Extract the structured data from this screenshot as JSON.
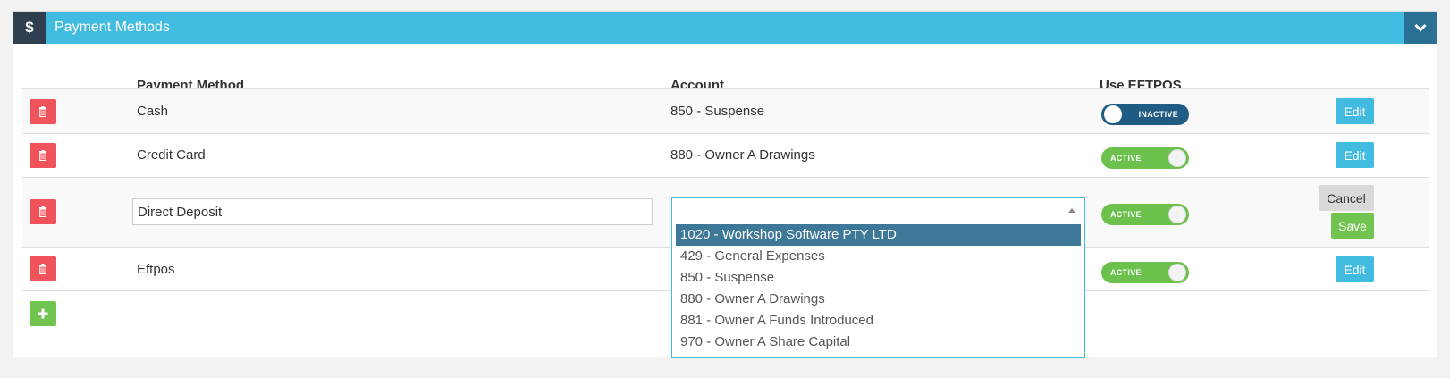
{
  "header": {
    "title": "Payment Methods",
    "icon": "$"
  },
  "columns": {
    "method": "Payment Method",
    "account": "Account",
    "eftpos": "Use EFTPOS"
  },
  "rows": [
    {
      "method": "Cash",
      "account": "850 - Suspense",
      "eftpos": "INACTIVE",
      "action": "Edit"
    },
    {
      "method": "Credit Card",
      "account": "880 - Owner A Drawings",
      "eftpos": "ACTIVE",
      "action": "Edit"
    },
    {
      "method": "Direct Deposit",
      "account": "",
      "eftpos": "ACTIVE",
      "cancel": "Cancel",
      "save": "Save"
    },
    {
      "method": "Eftpos",
      "account": "",
      "eftpos": "ACTIVE",
      "action": "Edit"
    }
  ],
  "dropdown": {
    "options": [
      "1020 - Workshop Software PTY LTD",
      "429 - General Expenses",
      "850 - Suspense",
      "880 - Owner A Drawings",
      "881 - Owner A Funds Introduced",
      "970 - Owner A Share Capital"
    ],
    "highlighted": "1020 - Workshop Software PTY LTD"
  },
  "colors": {
    "header": "#41bbe0",
    "header_icon_bg": "#2f3f4f",
    "collapse_bg": "#2a6f94",
    "delete": "#f0535a",
    "add": "#71c44f",
    "toggle_active": "#6bc14c",
    "toggle_inactive": "#1f5b82",
    "dropdown_selected": "#3d7899"
  },
  "icons": {
    "header": "dollar-icon",
    "collapse": "chevron-down-icon",
    "delete": "trash-icon",
    "add": "plus-icon",
    "select": "caret-up-icon"
  }
}
